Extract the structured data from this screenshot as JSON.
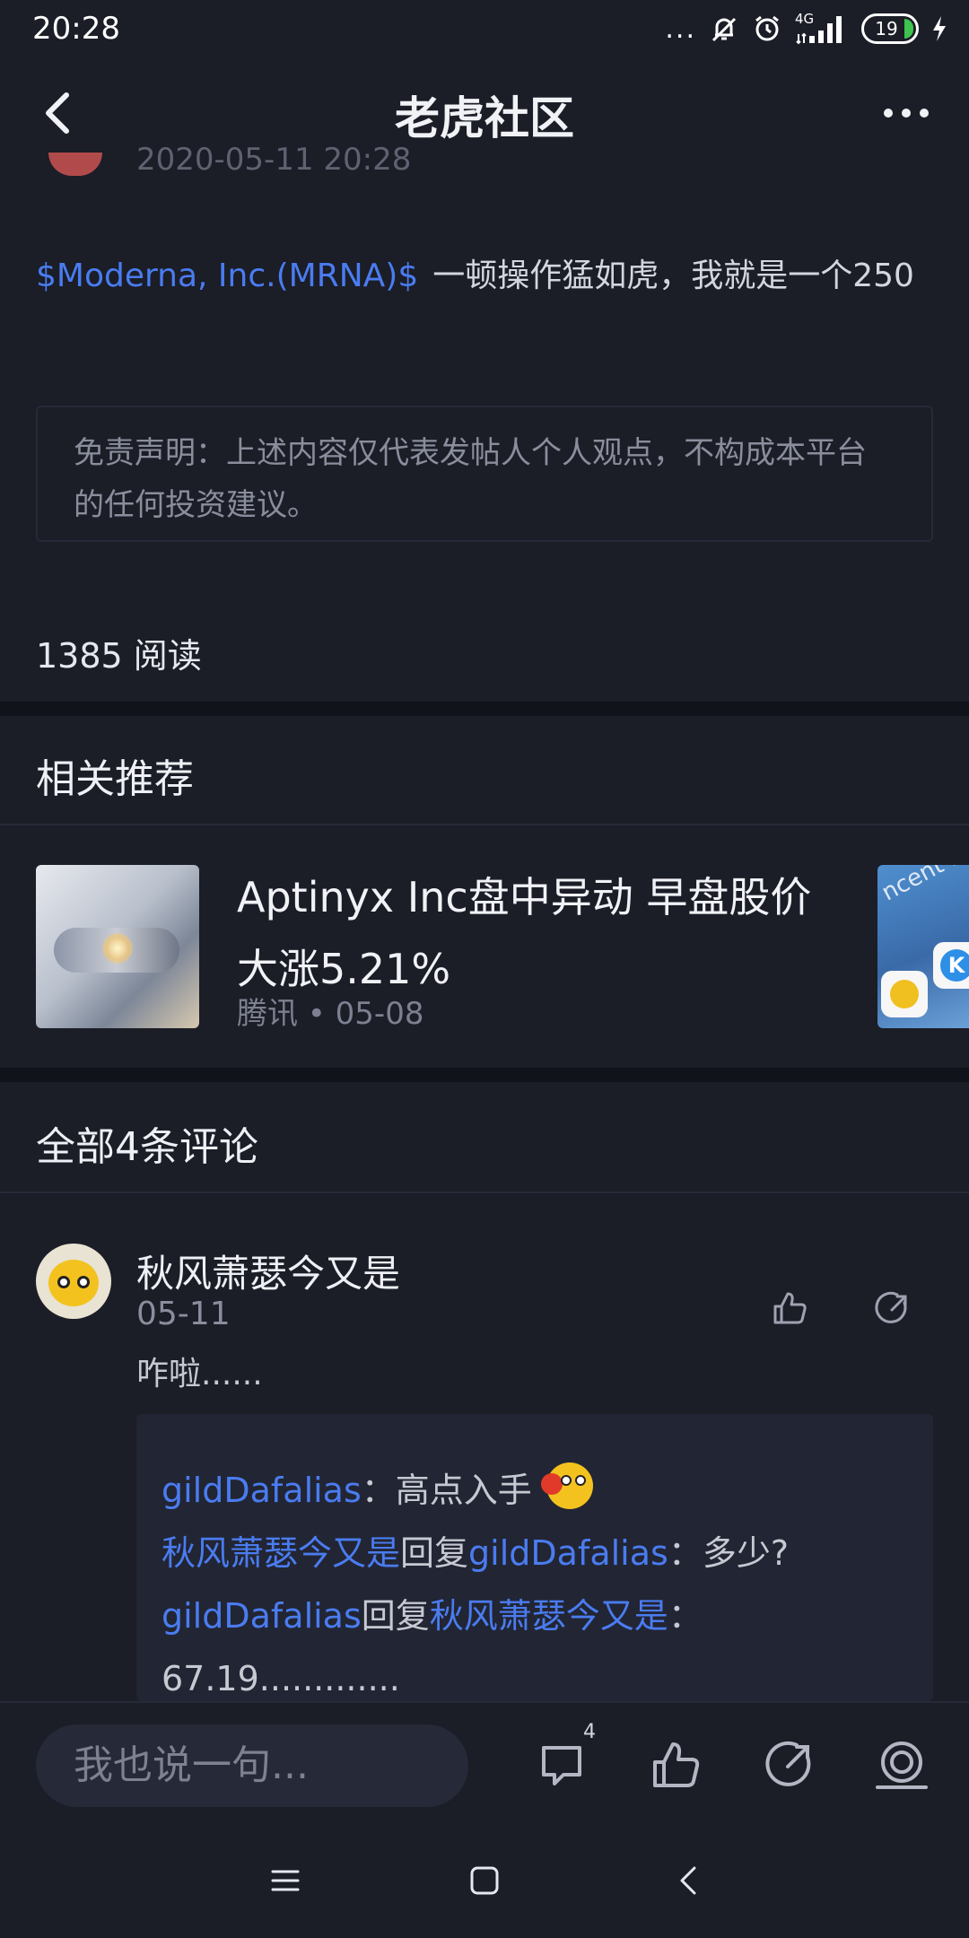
{
  "status_bar": {
    "time": "20:28",
    "more_dots": "...",
    "network": "4G",
    "battery": "19",
    "battery_color": "#3ec34f"
  },
  "header": {
    "title": "老虎社区",
    "back_icon": "chevron-left-icon",
    "more_icon": "more-horizontal-icon"
  },
  "post": {
    "date_partial": "2020-05-11 20:28",
    "ticker": "$Moderna, Inc.(MRNA)$",
    "body": "一顿操作猛如虎，我就是一个250",
    "disclaimer": "免责声明：上述内容仅代表发帖人个人观点，不构成本平台的任何投资建议。",
    "reads": "1385 阅读"
  },
  "recommend": {
    "section_title": "相关推荐",
    "items": [
      {
        "title": "Aptinyx Inc盘中异动 早盘股价大涨5.21%",
        "meta": "腾讯 • 05-08"
      }
    ],
    "peek_text": "ncent Mu",
    "peek_app_letter": "K"
  },
  "comments": {
    "section_title": "全部4条评论",
    "items": [
      {
        "author": "秋风萧瑟今又是",
        "date": "05-11",
        "text": "咋啦......",
        "replies": [
          {
            "user": "gildDafalias",
            "sep": "：",
            "text": "高点入手"
          },
          {
            "user": "秋风萧瑟今又是",
            "mid": "回复",
            "target": "gildDafalias",
            "sep": "：",
            "text": "多少?"
          },
          {
            "user": "gildDafalias",
            "mid": "回复",
            "target": "秋风萧瑟今又是",
            "sep": "：",
            "text": ""
          },
          {
            "text": "67.19............."
          }
        ]
      }
    ]
  },
  "bottom_bar": {
    "input_placeholder": "我也说一句...",
    "comment_count": "4"
  },
  "colors": {
    "accent": "#4a7cf0",
    "background": "#1b1d27",
    "divider": "#11131a"
  }
}
